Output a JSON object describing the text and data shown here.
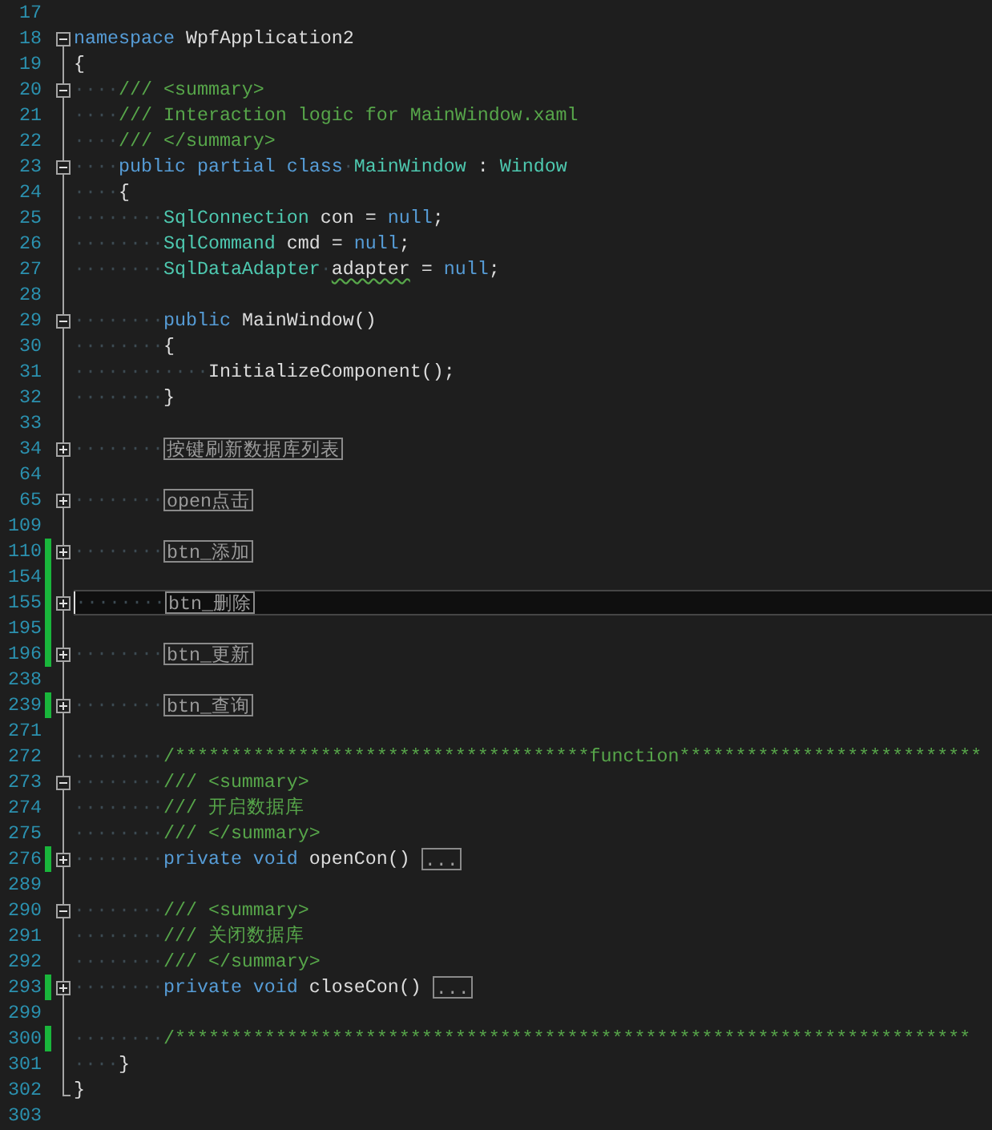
{
  "editor": {
    "lines": [
      {
        "number": "17",
        "changed": false,
        "current": false
      },
      {
        "number": "18",
        "collapsed": false,
        "changed": false,
        "current": false,
        "tokens": [
          {
            "kind": "keyword",
            "text": "namespace"
          },
          {
            "kind": "plain",
            "text": " WpfApplication2"
          }
        ]
      },
      {
        "number": "19",
        "changed": false,
        "current": false,
        "tokens": [
          {
            "kind": "plain",
            "text": "{"
          }
        ]
      },
      {
        "number": "20",
        "collapsed": false,
        "changed": false,
        "current": false,
        "indent": "····",
        "tokens": [
          {
            "kind": "comment",
            "text": "/// <summary>"
          }
        ]
      },
      {
        "number": "21",
        "changed": false,
        "current": false,
        "indent": "····",
        "tokens": [
          {
            "kind": "comment",
            "text": "/// Interaction logic for MainWindow.xaml"
          }
        ]
      },
      {
        "number": "22",
        "changed": false,
        "current": false,
        "indent": "····",
        "tokens": [
          {
            "kind": "comment",
            "text": "/// </summary>"
          }
        ]
      },
      {
        "number": "23",
        "collapsed": false,
        "changed": false,
        "current": false,
        "indent": "····",
        "tokens": [
          {
            "kind": "keyword",
            "text": "public partial class"
          },
          {
            "kind": "space",
            "text": "·"
          },
          {
            "kind": "type",
            "text": "MainWindow"
          },
          {
            "kind": "plain",
            "text": " : "
          },
          {
            "kind": "type",
            "text": "Window"
          }
        ]
      },
      {
        "number": "24",
        "changed": false,
        "current": false,
        "indent": "····",
        "tokens": [
          {
            "kind": "plain",
            "text": "{"
          }
        ]
      },
      {
        "number": "25",
        "changed": false,
        "current": false,
        "indent": "········",
        "tokens": [
          {
            "kind": "type",
            "text": "SqlConnection"
          },
          {
            "kind": "plain",
            "text": " con = "
          },
          {
            "kind": "keyword",
            "text": "null"
          },
          {
            "kind": "plain",
            "text": ";"
          }
        ]
      },
      {
        "number": "26",
        "changed": false,
        "current": false,
        "indent": "········",
        "tokens": [
          {
            "kind": "type",
            "text": "SqlCommand"
          },
          {
            "kind": "plain",
            "text": " cmd = "
          },
          {
            "kind": "keyword",
            "text": "null"
          },
          {
            "kind": "plain",
            "text": ";"
          }
        ]
      },
      {
        "number": "27",
        "changed": false,
        "current": false,
        "indent": "········",
        "tokens": [
          {
            "kind": "type",
            "text": "SqlDataAdapter"
          },
          {
            "kind": "space",
            "text": "·"
          },
          {
            "kind": "squiggle",
            "text": "adapter"
          },
          {
            "kind": "plain",
            "text": " = "
          },
          {
            "kind": "keyword",
            "text": "null"
          },
          {
            "kind": "plain",
            "text": ";"
          }
        ]
      },
      {
        "number": "28",
        "changed": false,
        "current": false
      },
      {
        "number": "29",
        "collapsed": false,
        "changed": false,
        "current": false,
        "indent": "········",
        "tokens": [
          {
            "kind": "keyword",
            "text": "public"
          },
          {
            "kind": "plain",
            "text": " MainWindow()"
          }
        ]
      },
      {
        "number": "30",
        "changed": false,
        "current": false,
        "indent": "········",
        "tokens": [
          {
            "kind": "plain",
            "text": "{"
          }
        ]
      },
      {
        "number": "31",
        "changed": false,
        "current": false,
        "indent": "············",
        "tokens": [
          {
            "kind": "plain",
            "text": "InitializeComponent();"
          }
        ]
      },
      {
        "number": "32",
        "changed": false,
        "current": false,
        "indent": "········",
        "tokens": [
          {
            "kind": "plain",
            "text": "}"
          }
        ]
      },
      {
        "number": "33",
        "changed": false,
        "current": false
      },
      {
        "number": "34",
        "collapsed": true,
        "changed": false,
        "current": false,
        "indent": "········",
        "tokens": [
          {
            "kind": "collapsed",
            "text": "按键刷新数据库列表"
          }
        ]
      },
      {
        "number": "64",
        "changed": false,
        "current": false
      },
      {
        "number": "65",
        "collapsed": true,
        "changed": false,
        "current": false,
        "indent": "········",
        "tokens": [
          {
            "kind": "collapsed",
            "text": "open点击"
          }
        ]
      },
      {
        "number": "109",
        "changed": false,
        "current": false
      },
      {
        "number": "110",
        "collapsed": true,
        "changed": true,
        "current": false,
        "indent": "········",
        "tokens": [
          {
            "kind": "collapsed",
            "text": "btn_添加"
          }
        ]
      },
      {
        "number": "154",
        "changed": true,
        "current": false
      },
      {
        "number": "155",
        "collapsed": true,
        "changed": true,
        "current": true,
        "indent": "········",
        "tokens": [
          {
            "kind": "collapsed",
            "text": "btn_删除"
          }
        ]
      },
      {
        "number": "195",
        "changed": true,
        "current": false
      },
      {
        "number": "196",
        "collapsed": true,
        "changed": true,
        "current": false,
        "indent": "········",
        "tokens": [
          {
            "kind": "collapsed",
            "text": "btn_更新"
          }
        ]
      },
      {
        "number": "238",
        "changed": false,
        "current": false
      },
      {
        "number": "239",
        "collapsed": true,
        "changed": true,
        "current": false,
        "indent": "········",
        "tokens": [
          {
            "kind": "collapsed",
            "text": "btn_查询"
          }
        ]
      },
      {
        "number": "271",
        "changed": false,
        "current": false
      },
      {
        "number": "272",
        "changed": false,
        "current": false,
        "indent": "········",
        "tokens": [
          {
            "kind": "comment",
            "text": "/*************************************function***************************"
          }
        ]
      },
      {
        "number": "273",
        "collapsed": false,
        "changed": false,
        "current": false,
        "indent": "········",
        "tokens": [
          {
            "kind": "comment",
            "text": "/// <summary>"
          }
        ]
      },
      {
        "number": "274",
        "changed": false,
        "current": false,
        "indent": "········",
        "tokens": [
          {
            "kind": "comment",
            "text": "/// 开启数据库"
          }
        ]
      },
      {
        "number": "275",
        "changed": false,
        "current": false,
        "indent": "········",
        "tokens": [
          {
            "kind": "comment",
            "text": "/// </summary>"
          }
        ]
      },
      {
        "number": "276",
        "collapsed": true,
        "changed": true,
        "current": false,
        "indent": "········",
        "tokens": [
          {
            "kind": "keyword",
            "text": "private void"
          },
          {
            "kind": "plain",
            "text": " openCon() "
          },
          {
            "kind": "collapsed",
            "text": "..."
          }
        ]
      },
      {
        "number": "289",
        "changed": false,
        "current": false
      },
      {
        "number": "290",
        "collapsed": false,
        "changed": false,
        "current": false,
        "indent": "········",
        "tokens": [
          {
            "kind": "comment",
            "text": "/// <summary>"
          }
        ]
      },
      {
        "number": "291",
        "changed": false,
        "current": false,
        "indent": "········",
        "tokens": [
          {
            "kind": "comment",
            "text": "/// 关闭数据库"
          }
        ]
      },
      {
        "number": "292",
        "changed": false,
        "current": false,
        "indent": "········",
        "tokens": [
          {
            "kind": "comment",
            "text": "/// </summary>"
          }
        ]
      },
      {
        "number": "293",
        "collapsed": true,
        "changed": true,
        "current": false,
        "indent": "········",
        "tokens": [
          {
            "kind": "keyword",
            "text": "private void"
          },
          {
            "kind": "plain",
            "text": " closeCon() "
          },
          {
            "kind": "collapsed",
            "text": "..."
          }
        ]
      },
      {
        "number": "299",
        "changed": false,
        "current": false
      },
      {
        "number": "300",
        "changed": true,
        "current": false,
        "indent": "········",
        "tokens": [
          {
            "kind": "comment",
            "text": "/***********************************************************************"
          }
        ]
      },
      {
        "number": "301",
        "changed": false,
        "current": false,
        "indent": "····",
        "tokens": [
          {
            "kind": "plain",
            "text": "}"
          }
        ]
      },
      {
        "number": "302",
        "changed": false,
        "current": false,
        "tokens": [
          {
            "kind": "plain",
            "text": "}"
          }
        ]
      },
      {
        "number": "303",
        "changed": false,
        "current": false
      }
    ]
  }
}
